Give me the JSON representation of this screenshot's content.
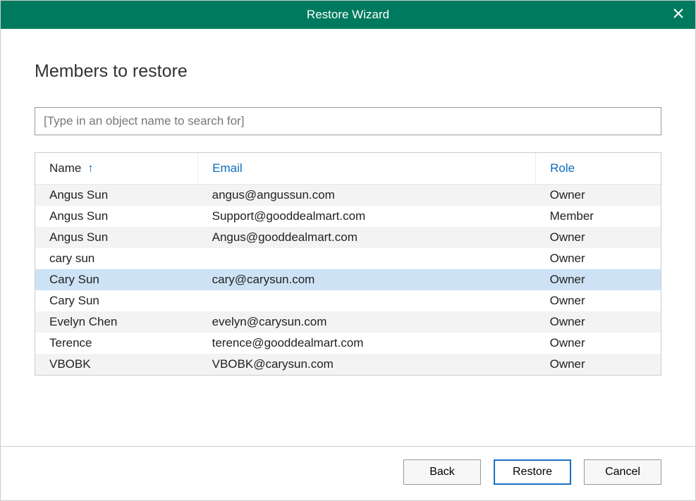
{
  "window": {
    "title": "Restore Wizard"
  },
  "heading": "Members to restore",
  "search": {
    "placeholder": "[Type in an object name to search for]",
    "value": ""
  },
  "table": {
    "columns": {
      "name": "Name",
      "email": "Email",
      "role": "Role"
    },
    "sort": {
      "column": "name",
      "dir": "asc",
      "indicator": "↑"
    },
    "rows": [
      {
        "name": "Angus Sun",
        "email": "angus@angussun.com",
        "role": "Owner",
        "selected": false
      },
      {
        "name": "Angus Sun",
        "email": "Support@gooddealmart.com",
        "role": "Member",
        "selected": false
      },
      {
        "name": "Angus Sun",
        "email": "Angus@gooddealmart.com",
        "role": "Owner",
        "selected": false
      },
      {
        "name": "cary sun",
        "email": "",
        "role": "Owner",
        "selected": false
      },
      {
        "name": "Cary Sun",
        "email": "cary@carysun.com",
        "role": "Owner",
        "selected": true
      },
      {
        "name": "Cary Sun",
        "email": "",
        "role": "Owner",
        "selected": false
      },
      {
        "name": "Evelyn Chen",
        "email": "evelyn@carysun.com",
        "role": "Owner",
        "selected": false
      },
      {
        "name": "Terence",
        "email": "terence@gooddealmart.com",
        "role": "Owner",
        "selected": false
      },
      {
        "name": "VBOBK",
        "email": "VBOBK@carysun.com",
        "role": "Owner",
        "selected": false
      }
    ]
  },
  "buttons": {
    "back": "Back",
    "restore": "Restore",
    "cancel": "Cancel"
  }
}
